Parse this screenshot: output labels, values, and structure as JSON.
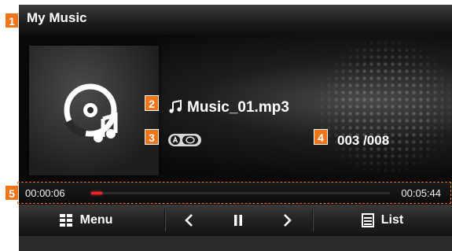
{
  "header": {
    "title": "My Music"
  },
  "now_playing": {
    "track_name": "Music_01.mp3",
    "counter": "003 /008"
  },
  "progress": {
    "elapsed": "00:00:06",
    "total": "00:05:44",
    "fraction": 0.017
  },
  "controls": {
    "menu_label": "Menu",
    "list_label": "List"
  },
  "callouts": [
    "1",
    "2",
    "3",
    "4",
    "5"
  ],
  "icons": [
    "music-disc-icon",
    "music-note-icon",
    "play-mode-icon",
    "menu-grid-icon",
    "previous-icon",
    "pause-icon",
    "next-icon",
    "list-icon"
  ],
  "colors": {
    "accent": "#f07418",
    "progress": "#ff2020"
  }
}
